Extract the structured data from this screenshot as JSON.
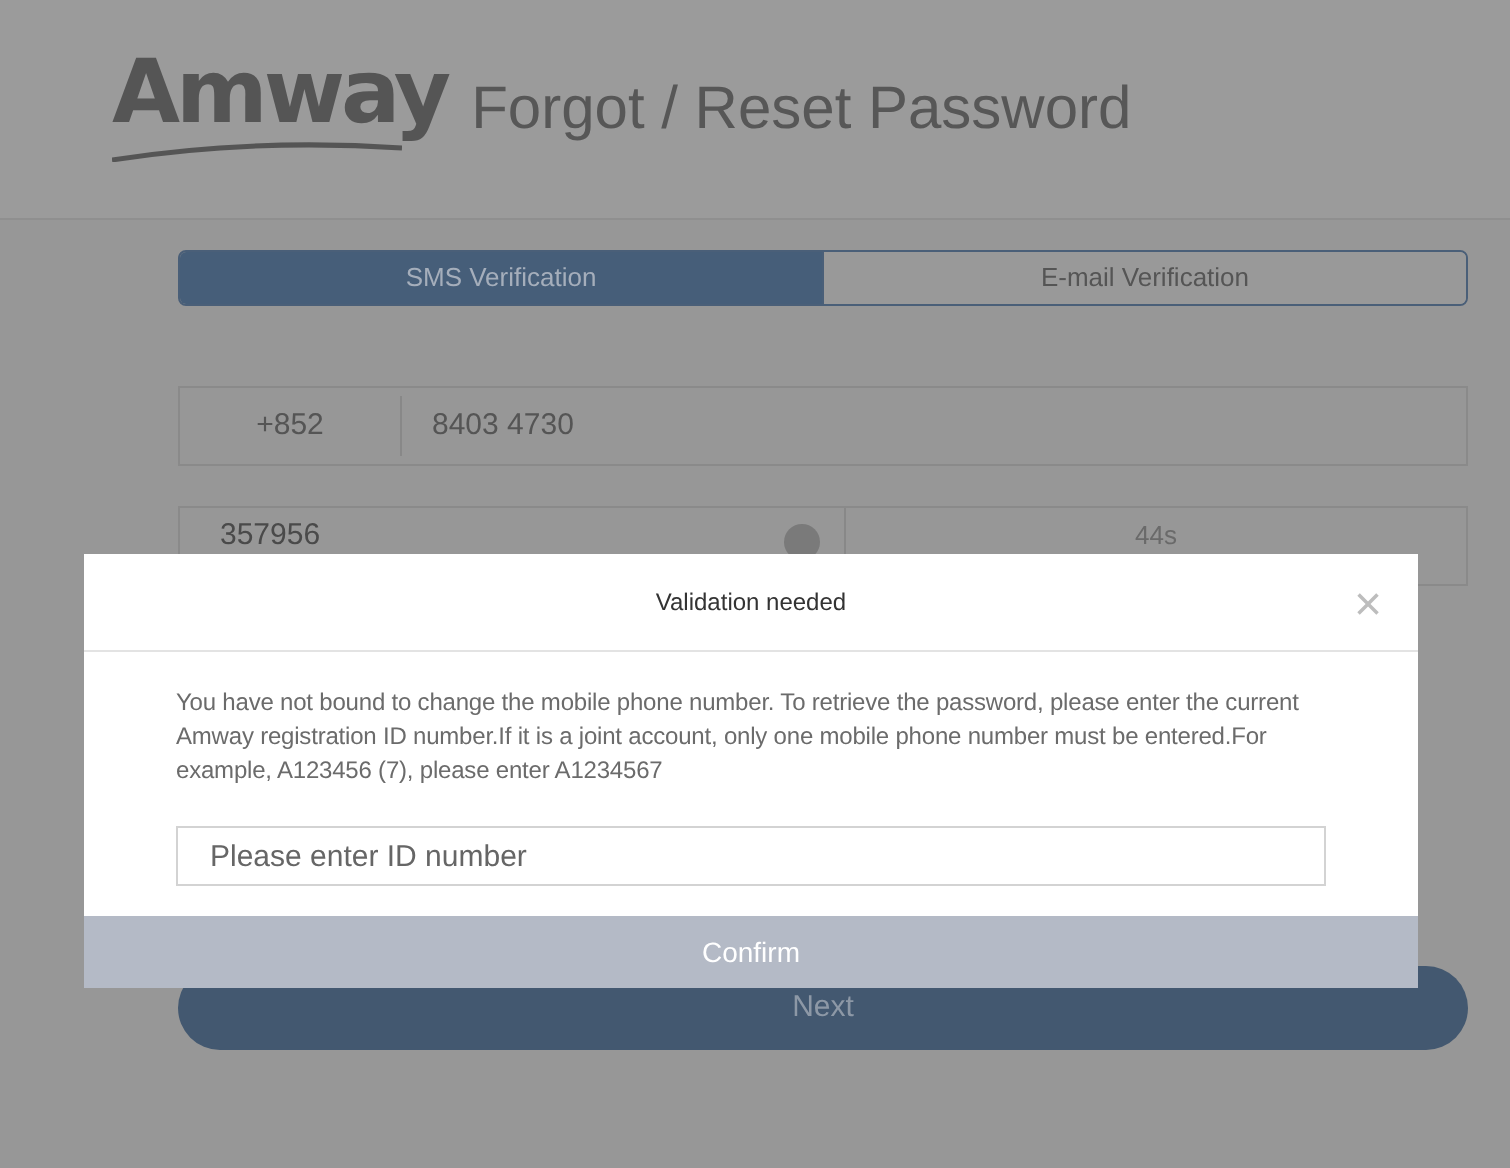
{
  "header": {
    "logo": "Amway",
    "title": "Forgot / Reset Password"
  },
  "tabs": [
    {
      "label": "SMS Verification",
      "selected": true
    },
    {
      "label": "E-mail Verification",
      "selected": false
    }
  ],
  "phone": {
    "country_code": "+852",
    "value": "8403 4730"
  },
  "code": {
    "value": "357956",
    "countdown": "44s"
  },
  "next_button": "Next",
  "dialog": {
    "title": "Validation needed",
    "close": "×",
    "message": "You have not bound to change the mobile phone number. To retrieve the password, please enter the current Amway registration ID number.If it is a joint account, only one mobile phone number must be entered.For example, A123456 (7), please enter A1234567",
    "input": {
      "placeholder": "Please enter ID number"
    },
    "confirm": {
      "label": "Confirm",
      "disabled": true
    }
  }
}
